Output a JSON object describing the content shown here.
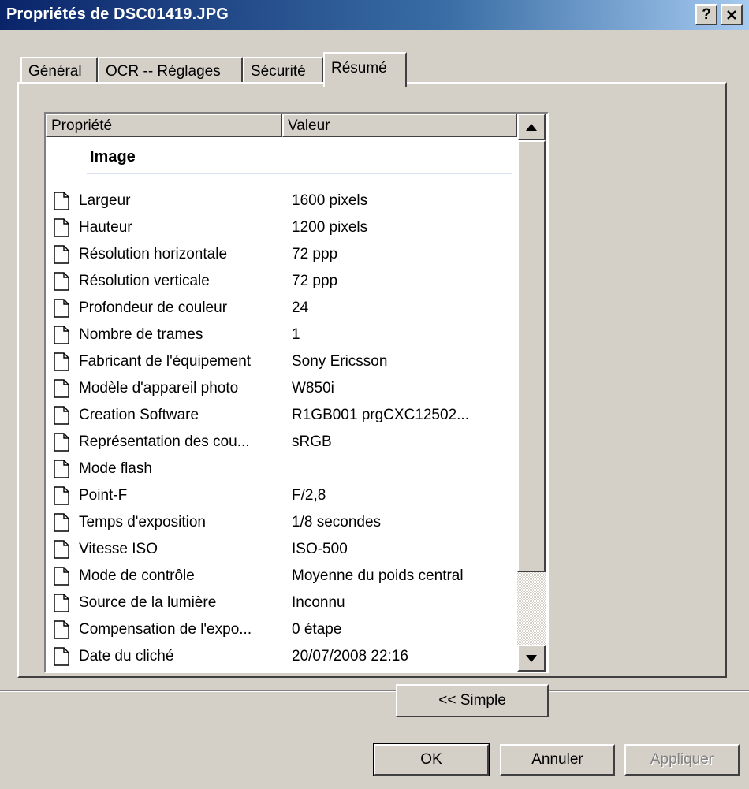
{
  "window": {
    "title": "Propriétés de DSC01419.JPG",
    "help_label": "?",
    "close_label": "×"
  },
  "tabs": [
    {
      "label": "Général",
      "active": false
    },
    {
      "label": "OCR -- Réglages",
      "active": false
    },
    {
      "label": "Sécurité",
      "active": false
    },
    {
      "label": "Résumé",
      "active": true
    }
  ],
  "list": {
    "columns": [
      "Propriété",
      "Valeur"
    ],
    "group": "Image",
    "rows": [
      {
        "name": "Largeur",
        "value": "1600 pixels"
      },
      {
        "name": "Hauteur",
        "value": "1200 pixels"
      },
      {
        "name": "Résolution horizontale",
        "value": "72 ppp"
      },
      {
        "name": "Résolution verticale",
        "value": "72 ppp"
      },
      {
        "name": "Profondeur de couleur",
        "value": "24"
      },
      {
        "name": "Nombre de trames",
        "value": "1"
      },
      {
        "name": "Fabricant de l'équipement",
        "value": "Sony Ericsson"
      },
      {
        "name": "Modèle d'appareil photo",
        "value": "W850i"
      },
      {
        "name": "Creation Software",
        "value": "R1GB001     prgCXC12502..."
      },
      {
        "name": "Représentation des cou...",
        "value": "sRGB"
      },
      {
        "name": "Mode flash",
        "value": ""
      },
      {
        "name": "Point-F",
        "value": "F/2,8"
      },
      {
        "name": "Temps d'exposition",
        "value": "1/8 secondes"
      },
      {
        "name": "Vitesse ISO",
        "value": "ISO-500"
      },
      {
        "name": "Mode de contrôle",
        "value": "Moyenne du poids central"
      },
      {
        "name": "Source de la lumière",
        "value": "Inconnu"
      },
      {
        "name": "Compensation de l'expo...",
        "value": "0 étape"
      },
      {
        "name": "Date du cliché",
        "value": "20/07/2008 22:16"
      }
    ]
  },
  "buttons": {
    "simple": "<< Simple",
    "ok": "OK",
    "cancel": "Annuler",
    "apply": "Appliquer"
  }
}
